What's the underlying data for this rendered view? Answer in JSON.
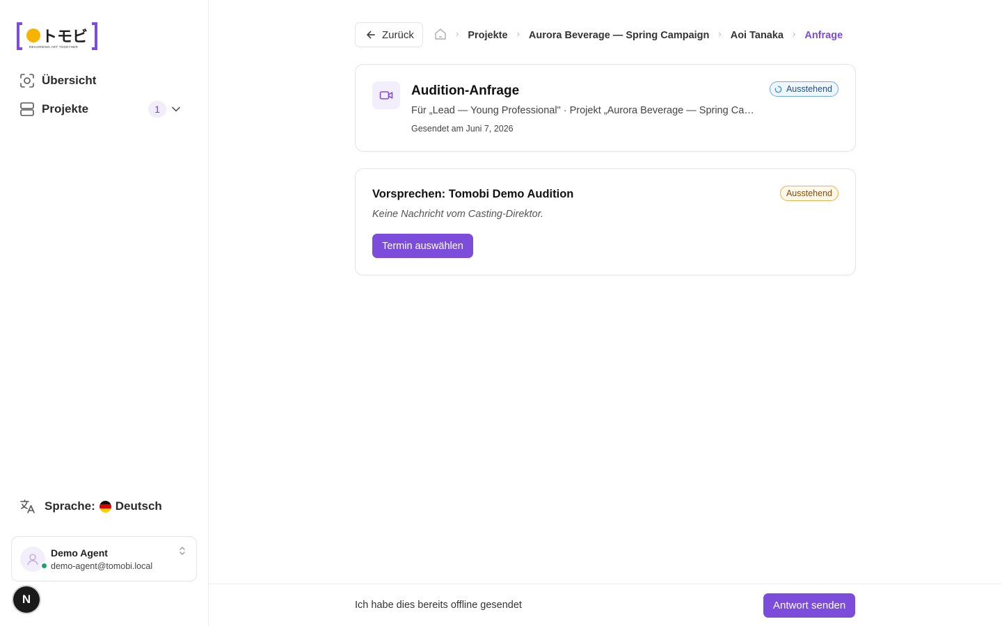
{
  "sidebar": {
    "logo": {
      "kana": "トモビ",
      "tagline": "RECORDING ART TOGETHER"
    },
    "nav": {
      "overview": "Übersicht",
      "projects": "Projekte",
      "projects_count": "1"
    },
    "language": {
      "label": "Sprache:",
      "value": "Deutsch"
    },
    "user": {
      "name": "Demo Agent",
      "email": "demo-agent@tomobi.local",
      "status": "online"
    },
    "n_button": "N"
  },
  "header": {
    "back_label": "Zurück",
    "breadcrumbs": [
      "Projekte",
      "Aurora Beverage — Spring Campaign",
      "Aoi Tanaka",
      "Anfrage"
    ]
  },
  "request_card": {
    "title": "Audition-Anfrage",
    "subtitle": "Für „Lead — Young Professional\" · Projekt „Aurora Beverage — Spring Campaign\"",
    "sent": "Gesendet am Juni 7, 2026",
    "status": "Ausstehend"
  },
  "audition_card": {
    "title": "Vorsprechen: Tomobi Demo Audition",
    "note": "Keine Nachricht vom Casting-Direktor.",
    "status": "Ausstehend",
    "button": "Termin auswählen"
  },
  "footer": {
    "offline_text": "Ich habe dies bereits offline gesendet",
    "send_button": "Antwort senden"
  },
  "colors": {
    "accent": "#7c4ddb",
    "status_blue": "#6aa9e8",
    "status_amber": "#e7b24c",
    "online": "#22a06b"
  }
}
